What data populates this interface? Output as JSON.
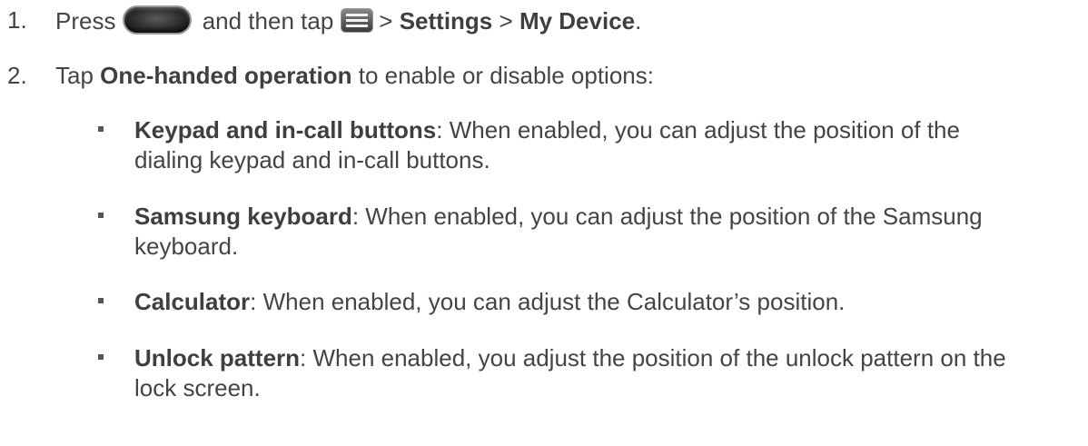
{
  "steps": [
    {
      "number": "1.",
      "press": "Press",
      "then_tap": "and then tap",
      "sep1": ">",
      "settings": "Settings",
      "sep2": ">",
      "my_device": "My Device",
      "end": "."
    },
    {
      "number": "2.",
      "tap": "Tap",
      "option": "One-handed operation",
      "rest": "to enable or disable options:"
    }
  ],
  "options": [
    {
      "name": "Keypad and in-call buttons",
      "desc_line1": ": When enabled, you can adjust the position of the",
      "desc_line2": "dialing keypad and in-call buttons."
    },
    {
      "name": "Samsung keyboard",
      "desc_line1": ": When enabled, you can adjust the position of the Samsung",
      "desc_line2": "keyboard."
    },
    {
      "name": "Calculator",
      "desc_line1": ": When enabled, you can adjust the Calculator’s position.",
      "desc_line2": ""
    },
    {
      "name": "Unlock pattern",
      "desc_line1": ": When enabled, you adjust the position of the unlock pattern on the",
      "desc_line2": "lock screen."
    }
  ],
  "icons": {
    "home": "home-button-icon",
    "menu": "menu-icon"
  }
}
